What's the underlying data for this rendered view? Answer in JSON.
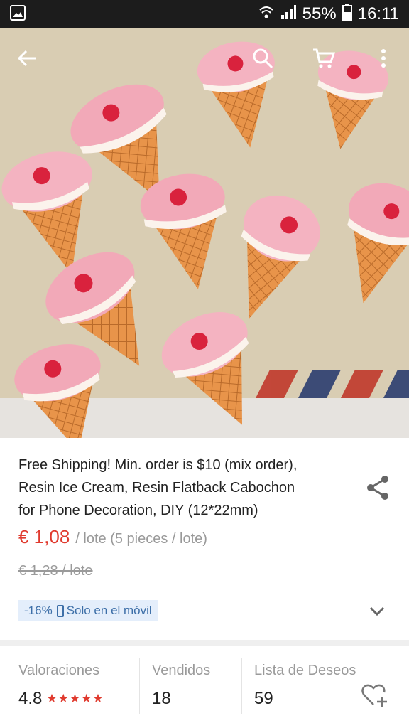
{
  "status_bar": {
    "battery": "55%",
    "time": "16:11",
    "icons": [
      "image-notification-icon",
      "wifi-icon",
      "signal-icon",
      "battery-icon"
    ]
  },
  "header": {
    "icons": [
      "back-arrow-icon",
      "search-icon",
      "cart-icon",
      "more-vert-icon"
    ]
  },
  "product": {
    "title_lines": [
      "Free Shipping! Min. order is $10 (mix order),",
      "Resin Ice Cream,  Resin Flatback Cabochon",
      "for Phone Decoration, DIY (12*22mm)"
    ],
    "price": "€ 1,08",
    "unit": "/ lote (5 pieces / lote)",
    "old_price": "€ 1,28 / lote",
    "promo_discount": "-16%",
    "promo_text": "Solo en el móvil"
  },
  "stats": {
    "ratings_label": "Valoraciones",
    "ratings_value": "4.8",
    "stars": "★★★★★",
    "sold_label": "Vendidos",
    "sold_value": "18",
    "wishlist_label": "Lista de Deseos",
    "wishlist_value": "59"
  },
  "colors": {
    "accent": "#e03a2e",
    "promo_bg": "#e4eefb",
    "promo_text": "#3d6fa8",
    "statusbar": "#1c1c1c"
  }
}
